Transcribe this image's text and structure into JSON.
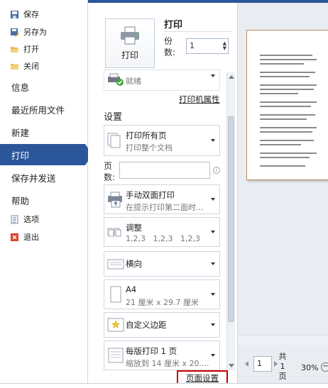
{
  "nav": {
    "small_items": [
      "保存",
      "另存为",
      "打开",
      "关闭"
    ],
    "big_items": [
      "信息",
      "最近所用文件",
      "新建",
      "打印",
      "保存并发送",
      "帮助"
    ],
    "bottom_items": [
      "选项",
      "退出"
    ],
    "active": "打印"
  },
  "print": {
    "button_label": "打印",
    "title": "打印",
    "copies_label": "份数:",
    "copies_value": "1"
  },
  "printer": {
    "status": "就绪",
    "properties_link": "打印机属性"
  },
  "settings": {
    "heading": "设置",
    "print_range": {
      "title": "打印所有页",
      "subtitle": "打印整个文档"
    },
    "pages_label": "页数:",
    "pages_value": "",
    "duplex": {
      "title": "手动双面打印",
      "subtitle": "在提示打印第二面时..."
    },
    "collate": {
      "title": "调整",
      "subtitle": "1,2,3   1,2,3   1,2,3"
    },
    "orientation": {
      "title": "横向"
    },
    "paper": {
      "title": "A4",
      "subtitle": "21 厘米 x 29.7 厘米"
    },
    "margins": {
      "title": "自定义边距"
    },
    "per_sheet": {
      "title": "每版打印 1 页",
      "subtitle": "缩放到 14 厘米 x 20...."
    },
    "page_setup_link": "页面设置"
  },
  "preview": {
    "page_value": "1",
    "total_label": "共 1 页",
    "zoom": "30%"
  },
  "colors": {
    "accent": "#2b579a",
    "highlight_box": "#cc0000"
  }
}
